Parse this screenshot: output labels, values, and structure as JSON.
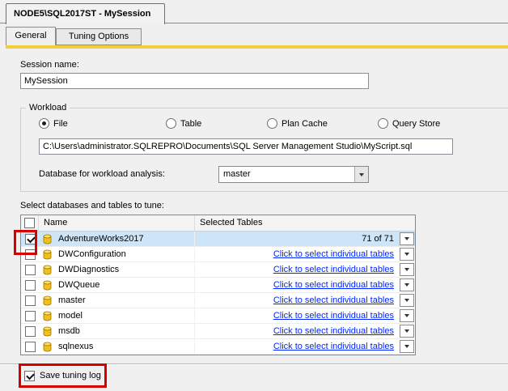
{
  "window": {
    "title_tab": "NODE5\\SQL2017ST - MySession"
  },
  "tabs": {
    "general": "General",
    "tuning_options": "Tuning Options",
    "active_tab": "General"
  },
  "session": {
    "label": "Session name:",
    "value": "MySession"
  },
  "workload": {
    "group_label": "Workload",
    "radio_file": "File",
    "radio_table": "Table",
    "radio_plan_cache": "Plan Cache",
    "radio_query_store": "Query Store",
    "selected_radio": "File",
    "file_path": "C:\\Users\\administrator.SQLREPRO\\Documents\\SQL Server Management Studio\\MyScript.sql",
    "database_label": "Database for workload analysis:",
    "database_value": "master"
  },
  "tables": {
    "section_label": "Select databases and tables to tune:",
    "header": {
      "name": "Name",
      "selected_tables": "Selected Tables"
    },
    "rows": [
      {
        "name": "AdventureWorks2017",
        "checked": true,
        "selected": "71 of 71",
        "is_link": false,
        "highlighted": true
      },
      {
        "name": "DWConfiguration",
        "checked": false,
        "selected": "Click to select individual tables",
        "is_link": true
      },
      {
        "name": "DWDiagnostics",
        "checked": false,
        "selected": "Click to select individual tables",
        "is_link": true
      },
      {
        "name": "DWQueue",
        "checked": false,
        "selected": "Click to select individual tables",
        "is_link": true
      },
      {
        "name": "master",
        "checked": false,
        "selected": "Click to select individual tables",
        "is_link": true
      },
      {
        "name": "model",
        "checked": false,
        "selected": "Click to select individual tables",
        "is_link": true
      },
      {
        "name": "msdb",
        "checked": false,
        "selected": "Click to select individual tables",
        "is_link": true
      },
      {
        "name": "sqlnexus",
        "checked": false,
        "selected": "Click to select individual tables",
        "is_link": true
      }
    ]
  },
  "footer": {
    "save_tuning_log": "Save tuning log",
    "checked": true
  },
  "colors": {
    "tab_accent": "#F2CE3A",
    "annotation_red": "#D50000",
    "link_blue": "#0026FF",
    "selected_row": "#CDE5F6",
    "background": "#F0F0F0"
  }
}
